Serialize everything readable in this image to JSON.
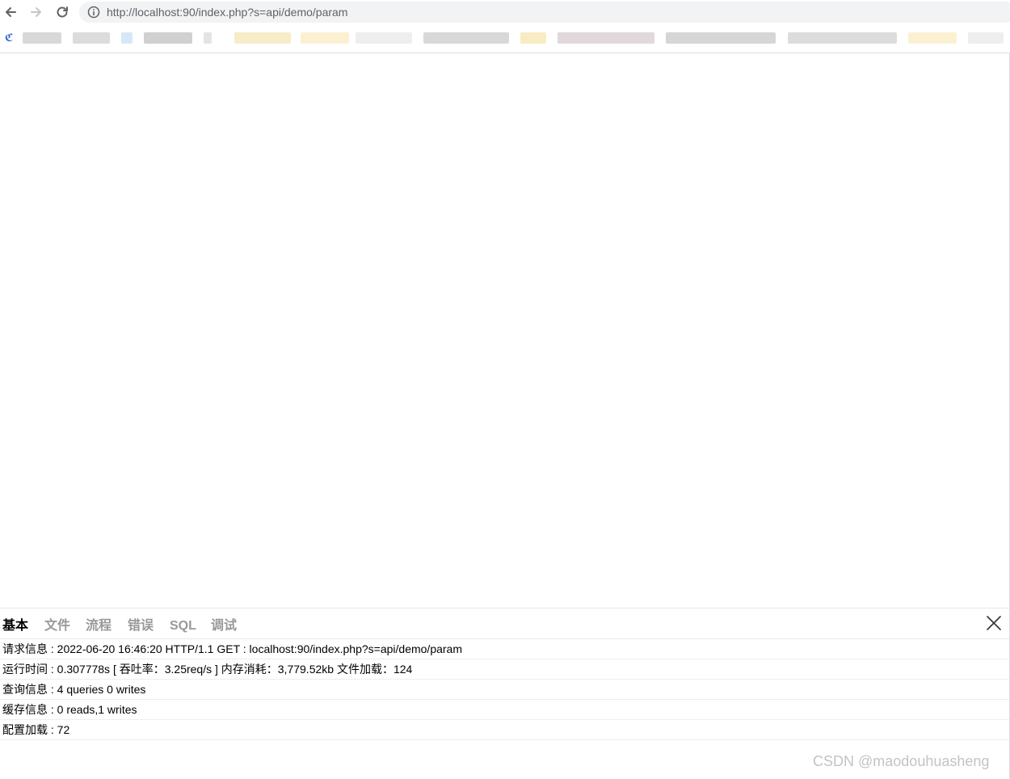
{
  "address_bar": {
    "url": "http://localhost:90/index.php?s=api/demo/param"
  },
  "bookmarks_bar": {
    "items_obscured": true
  },
  "icons": {
    "back": "back-arrow-icon",
    "forward": "forward-arrow-icon",
    "reload": "reload-icon",
    "site_info": "info-circle-icon",
    "close": "close-x-icon"
  },
  "colors": {
    "active_tab": "#000000",
    "inactive_tab": "#999999",
    "row_divider": "#eeeeee",
    "omnibox_bg": "#f1f3f4"
  },
  "trace": {
    "tabs": [
      {
        "label": "基本",
        "active": true
      },
      {
        "label": "文件",
        "active": false
      },
      {
        "label": "流程",
        "active": false
      },
      {
        "label": "错误",
        "active": false
      },
      {
        "label": "SQL",
        "active": false
      },
      {
        "label": "调试",
        "active": false
      }
    ],
    "rows": [
      "请求信息 : 2022-06-20 16:46:20 HTTP/1.1 GET : localhost:90/index.php?s=api/demo/param",
      "运行时间 : 0.307778s [ 吞吐率：3.25req/s ] 内存消耗：3,779.52kb 文件加载：124",
      "查询信息 : 4 queries 0 writes",
      "缓存信息 : 0 reads,1 writes",
      "配置加载 : 72"
    ]
  },
  "watermark": "CSDN @maodouhuasheng"
}
